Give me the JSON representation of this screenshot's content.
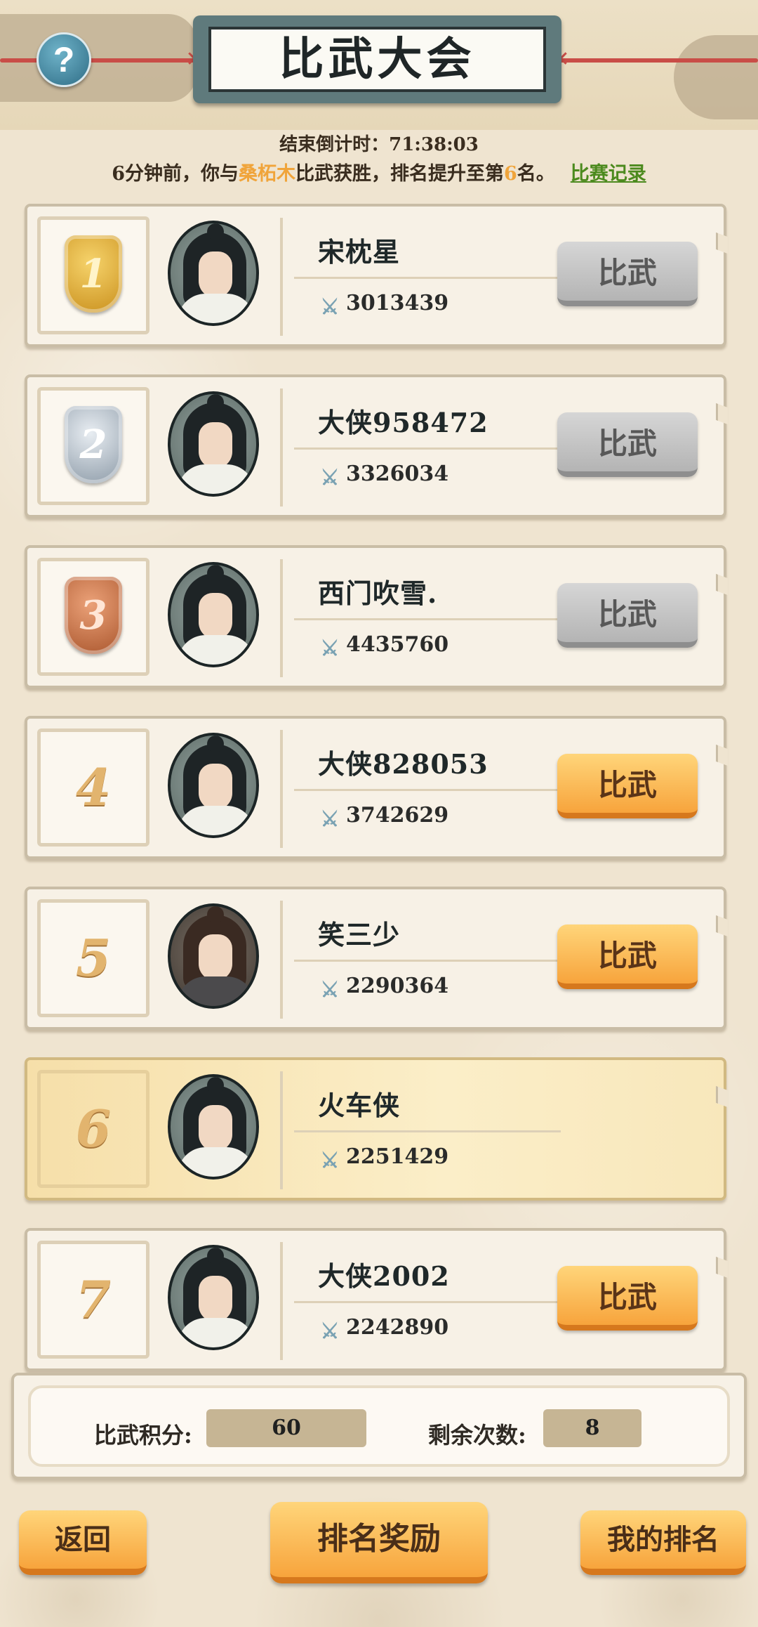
{
  "header": {
    "title": "比武大会",
    "help_icon": "?"
  },
  "countdown": {
    "label": "结束倒计时：",
    "value": "71:38:03"
  },
  "notice": {
    "prefix": "6分钟前，你与",
    "opponent": "桑柘木",
    "middle": "比武获胜，排名提升至第",
    "rank": "6",
    "suffix": "名。",
    "record_link": "比赛记录"
  },
  "fight_label": "比武",
  "rows": [
    {
      "rank": "1",
      "name": "宋枕星",
      "power": "3013439",
      "button": "grey",
      "medal": "gold",
      "avatar": "scholar"
    },
    {
      "rank": "2",
      "name": "大侠958472",
      "power": "3326034",
      "button": "grey",
      "medal": "silver",
      "avatar": "scholar"
    },
    {
      "rank": "3",
      "name": "西门吹雪.",
      "power": "4435760",
      "button": "grey",
      "medal": "bronze",
      "avatar": "scholar"
    },
    {
      "rank": "4",
      "name": "大侠828053",
      "power": "3742629",
      "button": "orange",
      "medal": "",
      "avatar": "scholar"
    },
    {
      "rank": "5",
      "name": "笑三少",
      "power": "2290364",
      "button": "orange",
      "medal": "",
      "avatar": "warrior"
    },
    {
      "rank": "6",
      "name": "火车侠",
      "power": "2251429",
      "button": "none",
      "medal": "",
      "avatar": "scholar",
      "is_self": true
    },
    {
      "rank": "7",
      "name": "大侠2002",
      "power": "2242890",
      "button": "orange",
      "medal": "",
      "avatar": "scholar"
    }
  ],
  "footer": {
    "score_label": "比武积分:",
    "score_value": "60",
    "remaining_label": "剩余次数:",
    "remaining_value": "8"
  },
  "buttons": {
    "back": "返回",
    "rank_reward": "排名奖励",
    "my_rank": "我的排名"
  },
  "colors": {
    "accent_orange": "#f7a43c",
    "highlight": "#f0a43a",
    "link_green": "#4c8a1e",
    "background": "#efe4d0"
  }
}
